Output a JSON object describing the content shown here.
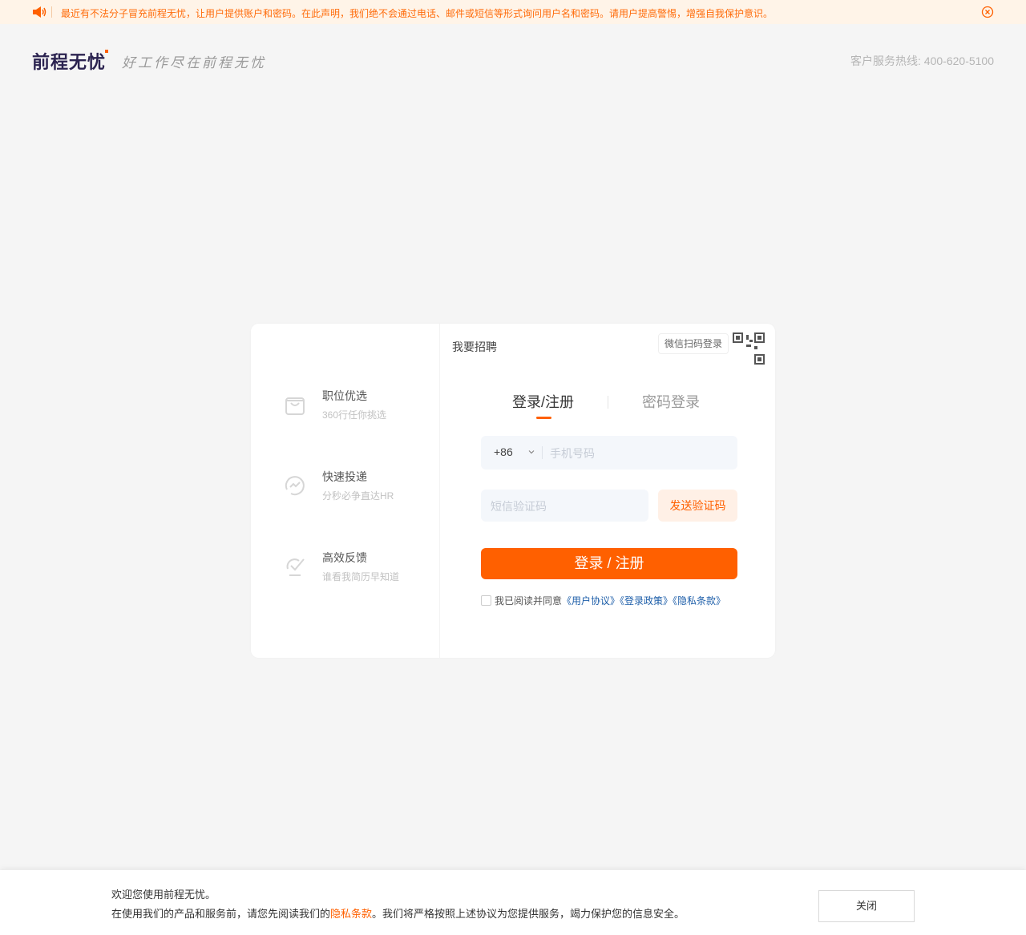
{
  "notice": {
    "text": "最近有不法分子冒充前程无忧，让用户提供账户和密码。在此声明，我们绝不会通过电话、邮件或短信等形式询问用户名和密码。请用户提高警惕，增强自我保护意识。",
    "speaker_icon": "speaker-icon",
    "close_icon": "close-circle-icon"
  },
  "header": {
    "logo": "前程无忧",
    "slogan": "好工作尽在前程无忧",
    "hotline": "客户服务热线: 400-620-5100"
  },
  "features": [
    {
      "title": "职位优选",
      "desc": "360行任你挑选",
      "icon": "shopping-bag-icon"
    },
    {
      "title": "快速投递",
      "desc": "分秒必争直达HR",
      "icon": "fast-send-icon"
    },
    {
      "title": "高效反馈",
      "desc": "谁看我简历早知道",
      "icon": "feedback-icon"
    }
  ],
  "login": {
    "recruit_link": "我要招聘",
    "wechat_tip": "微信扫码登录",
    "tabs": [
      "登录/注册",
      "密码登录"
    ],
    "country_code": "+86",
    "phone_placeholder": "手机号码",
    "code_placeholder": "短信验证码",
    "send_code": "发送验证码",
    "submit": "登录 / 注册",
    "agree_text": "我已阅读并同意",
    "agree_links": [
      "《用户协议》",
      "《登录政策》",
      "《隐私条款》"
    ]
  },
  "bottom": {
    "line1": "欢迎您使用前程无忧。",
    "line2_pre": "在使用我们的产品和服务前，请您先阅读我们的",
    "line2_link": "隐私条款",
    "line2_post": "。我们将严格按照上述协议为您提供服务，竭力保护您的信息安全。",
    "close": "关闭"
  },
  "colors": {
    "accent": "#ff6000",
    "notice_bg": "#fff4e8",
    "link": "#1d5ea9",
    "page_bg": "#f5f5f5"
  }
}
